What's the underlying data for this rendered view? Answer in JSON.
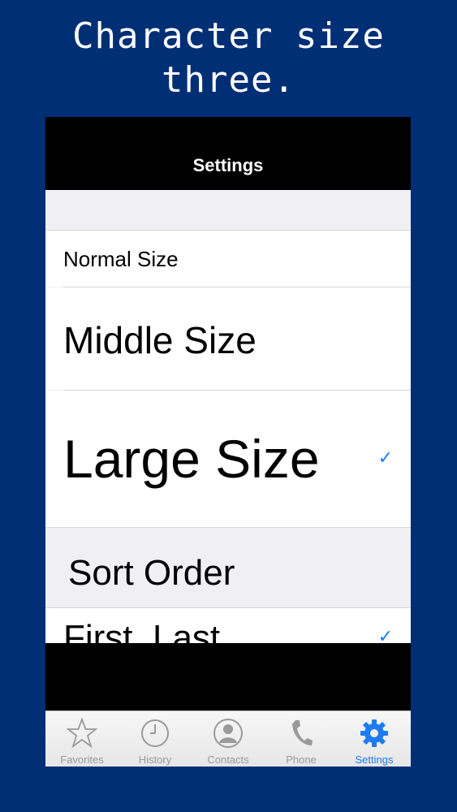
{
  "caption": {
    "line1": "Character size",
    "line2": "three."
  },
  "navbar": {
    "title": "Settings"
  },
  "size_options": [
    {
      "label": "Normal Size",
      "selected": false
    },
    {
      "label": "Middle Size",
      "selected": false
    },
    {
      "label": "Large Size",
      "selected": true,
      "check": "✓"
    }
  ],
  "sort_section": {
    "header": "Sort Order",
    "items": [
      {
        "label": "First, Last",
        "selected": true,
        "check": "✓"
      }
    ]
  },
  "tabbar": {
    "items": [
      {
        "label": "Favorites",
        "icon": "star-icon",
        "active": false
      },
      {
        "label": "History",
        "icon": "clock-icon",
        "active": false
      },
      {
        "label": "Contacts",
        "icon": "person-icon",
        "active": false
      },
      {
        "label": "Phone",
        "icon": "phone-icon",
        "active": false
      },
      {
        "label": "Settings",
        "icon": "gear-icon",
        "active": true
      }
    ]
  },
  "colors": {
    "background": "#002f75",
    "accent": "#1e7cf2"
  }
}
